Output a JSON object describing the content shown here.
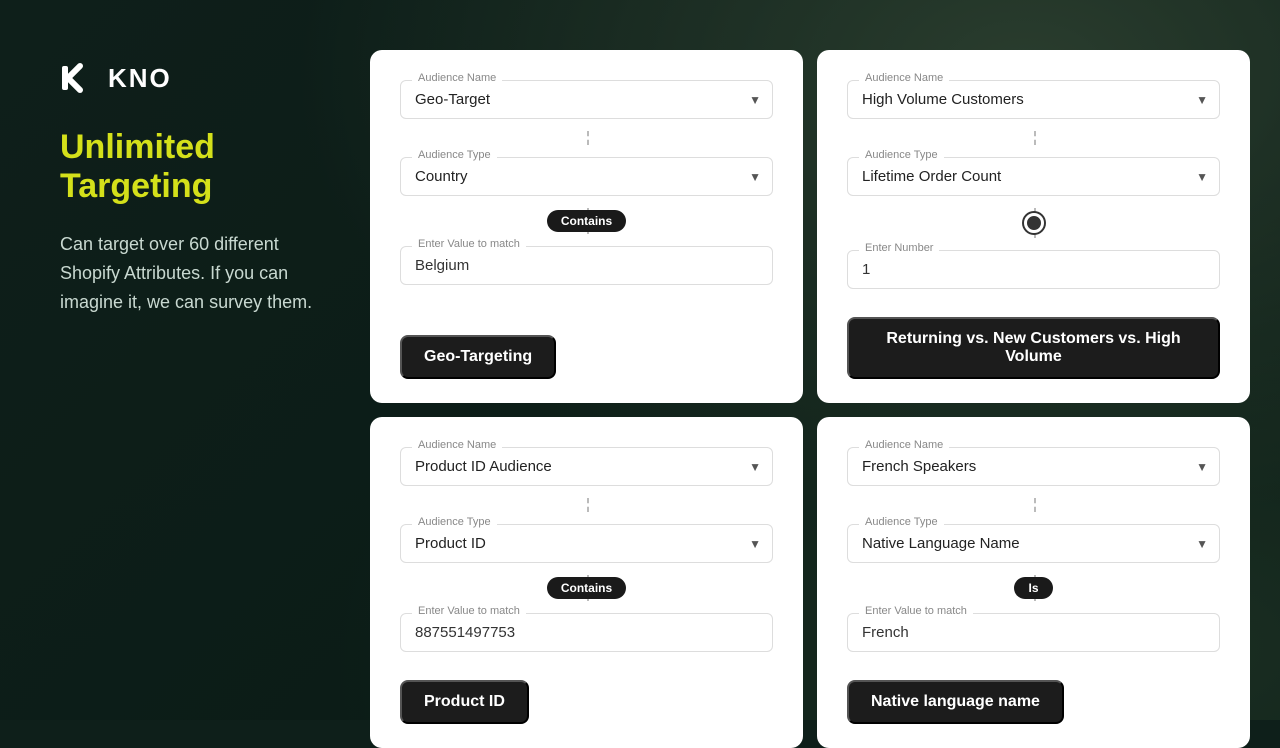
{
  "sidebar": {
    "logo_text": "KNO",
    "headline": "Unlimited\nTargeting",
    "description": "Can target over 60 different Shopify Attributes.  If you can imagine it, we can survey them."
  },
  "cards": [
    {
      "id": "geo-target",
      "audience_name_label": "Audience Name",
      "audience_name_value": "Geo-Target",
      "audience_type_label": "Audience Type",
      "audience_type_value": "Country",
      "badge": "Contains",
      "input_label": "Enter Value to match",
      "input_value": "Belgium",
      "footer_label": "Geo-Targeting"
    },
    {
      "id": "high-volume",
      "audience_name_label": "Audience Name",
      "audience_name_value": "High Volume Customers",
      "audience_type_label": "Audience Type",
      "audience_type_value": "Lifetime Order Count",
      "input_label": "Enter Number",
      "input_value": "1",
      "footer_label": "Returning vs. New Customers vs. High Volume"
    },
    {
      "id": "product-id",
      "audience_name_label": "Audience Name",
      "audience_name_value": "Product ID Audience",
      "audience_type_label": "Audience Type",
      "audience_type_value": "Product ID",
      "badge": "Contains",
      "input_label": "Enter Value to match",
      "input_value": "887551497753",
      "footer_label": "Product ID"
    },
    {
      "id": "french-speakers",
      "audience_name_label": "Audience Name",
      "audience_name_value": "French Speakers",
      "audience_type_label": "Audience Type",
      "audience_type_value": "Native Language Name",
      "badge": "Is",
      "input_label": "Enter Value to match",
      "input_value": "French",
      "footer_label": "Native language name"
    }
  ]
}
